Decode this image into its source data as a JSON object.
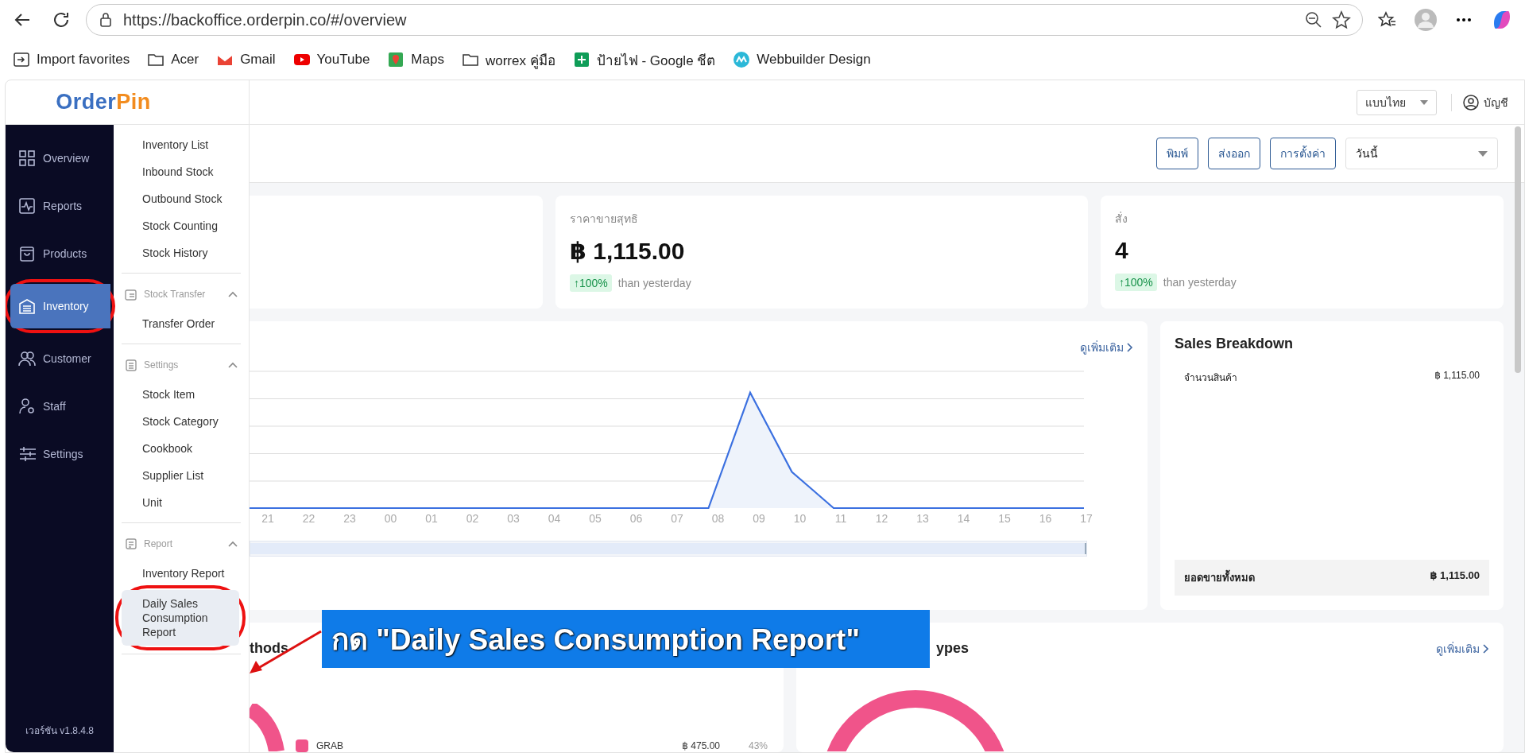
{
  "browser": {
    "url": "https://backoffice.orderpin.co/#/overview",
    "bookmarks": [
      {
        "kind": "import",
        "label": "Import favorites"
      },
      {
        "kind": "folder",
        "label": "Acer"
      },
      {
        "kind": "gmail",
        "label": "Gmail"
      },
      {
        "kind": "youtube",
        "label": "YouTube"
      },
      {
        "kind": "maps",
        "label": "Maps"
      },
      {
        "kind": "folder",
        "label": "worrex คู่มือ"
      },
      {
        "kind": "sheets",
        "label": "ป้ายไฟ - Google ชีต"
      },
      {
        "kind": "webbuilder",
        "label": "Webbuilder Design"
      }
    ]
  },
  "header": {
    "logo": [
      "Order",
      "Pin"
    ],
    "language": "แบบไทย",
    "account": "บัญชี"
  },
  "sidebar": {
    "items": [
      {
        "label": "Overview",
        "selected": false,
        "circled": false
      },
      {
        "label": "Reports",
        "selected": false,
        "circled": false
      },
      {
        "label": "Products",
        "selected": false,
        "circled": false
      },
      {
        "label": "Inventory",
        "selected": true,
        "circled": true
      },
      {
        "label": "Customer",
        "selected": false,
        "circled": false
      },
      {
        "label": "Staff",
        "selected": false,
        "circled": false
      },
      {
        "label": "Settings",
        "selected": false,
        "circled": false
      }
    ],
    "version": "เวอร์ชัน v1.8.4.8"
  },
  "submenu": {
    "groups": [
      {
        "items": [
          {
            "label": "Inventory List",
            "selected": false,
            "circled": false
          },
          {
            "label": "Inbound Stock",
            "selected": false,
            "circled": false
          },
          {
            "label": "Outbound Stock",
            "selected": false,
            "circled": false
          },
          {
            "label": "Stock Counting",
            "selected": false,
            "circled": false
          },
          {
            "label": "Stock History",
            "selected": false,
            "circled": false
          }
        ]
      },
      {
        "title": "Stock Transfer",
        "expanded": true,
        "items": [
          {
            "label": "Transfer Order",
            "selected": false,
            "circled": false
          }
        ]
      },
      {
        "title": "Settings",
        "expanded": true,
        "items": [
          {
            "label": "Stock Item",
            "selected": false,
            "circled": false
          },
          {
            "label": "Stock Category",
            "selected": false,
            "circled": false
          },
          {
            "label": "Cookbook",
            "selected": false,
            "circled": false
          },
          {
            "label": "Supplier List",
            "selected": false,
            "circled": false
          },
          {
            "label": "Unit",
            "selected": false,
            "circled": false
          }
        ]
      },
      {
        "title": "Report",
        "expanded": true,
        "items": [
          {
            "label": "Inventory Report",
            "selected": false,
            "circled": false
          },
          {
            "label": "Daily Sales Consumption Report",
            "selected": true,
            "circled": true
          }
        ]
      }
    ]
  },
  "toolbar": {
    "buttons": [
      "พิมพ์",
      "ส่งออก",
      "การตั้งค่า"
    ],
    "period": "วันนี้"
  },
  "stats": [
    {
      "label": "ราคาขายสุทธิ",
      "value": "฿ 1,115.00",
      "change": "↑100%",
      "note": "than yesterday"
    },
    {
      "label": "สั่ง",
      "value": "4",
      "change": "↑100%",
      "note": "than yesterday"
    }
  ],
  "sales_chart": {
    "more": "ดูเพิ่มเติม",
    "hours": [
      "21",
      "22",
      "23",
      "00",
      "01",
      "02",
      "03",
      "04",
      "05",
      "06",
      "07",
      "08",
      "09",
      "10",
      "11",
      "12",
      "13",
      "14",
      "15",
      "16",
      "17"
    ],
    "range": {
      "level": 1
    }
  },
  "sales_breakdown": {
    "title": "Sales Breakdown",
    "rows": [
      {
        "label": "จำนวนสินค้า",
        "value": "฿ 1,115.00"
      }
    ],
    "total": {
      "label": "ยอดขายทั้งหมด",
      "value": "฿ 1,115.00"
    }
  },
  "payment_methods": {
    "title": "thods",
    "legend": [
      {
        "label": "GRAB",
        "value": "฿ 475.00",
        "share": "43%",
        "color": "#f0548a"
      }
    ]
  },
  "order_types": {
    "title": "ypes",
    "more": "ดูเพิ่มเติม"
  },
  "annotation": {
    "text": "กด \"Daily Sales Consumption Report\""
  }
}
